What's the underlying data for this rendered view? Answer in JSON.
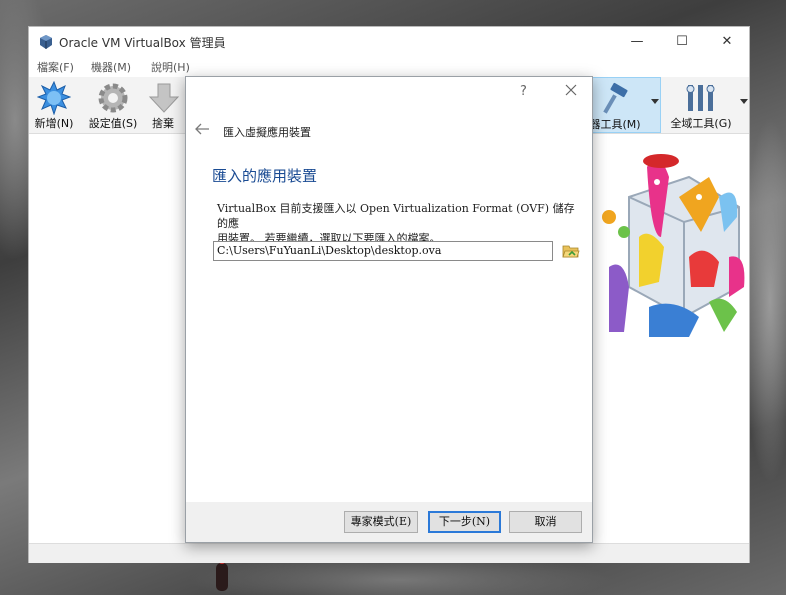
{
  "window": {
    "title": "Oracle VM VirtualBox 管理員",
    "minimize": "—",
    "maximize": "☐",
    "close": "✕"
  },
  "menu": [
    {
      "label": "檔案(F)"
    },
    {
      "label": "機器(M)"
    },
    {
      "label": "說明(H)"
    }
  ],
  "toolbar": {
    "new_label": "新增(N)",
    "settings_label": "設定值(S)",
    "discard_label": "捨棄",
    "machine_tools_label": "器工具(M)",
    "global_tools_label": "全域工具(G)"
  },
  "dialog": {
    "help": "?",
    "header": "匯入虛擬應用裝置",
    "heading": "匯入的應用裝置",
    "description_line1": "VirtualBox 目前支援匯入以 Open Virtualization Format (OVF) 儲存的應",
    "description_line2": "用裝置。 若要繼續，選取以下要匯入的檔案。",
    "file_path": "C:\\Users\\FuYuanLi\\Desktop\\desktop.ova",
    "expert_mode_label": "專家模式(E)",
    "next_label": "下一步(N)",
    "cancel_label": "取消"
  },
  "colors": {
    "accent": "#2b79d8",
    "heading": "#1a4b93",
    "active_tool_bg": "#cde6f7"
  }
}
